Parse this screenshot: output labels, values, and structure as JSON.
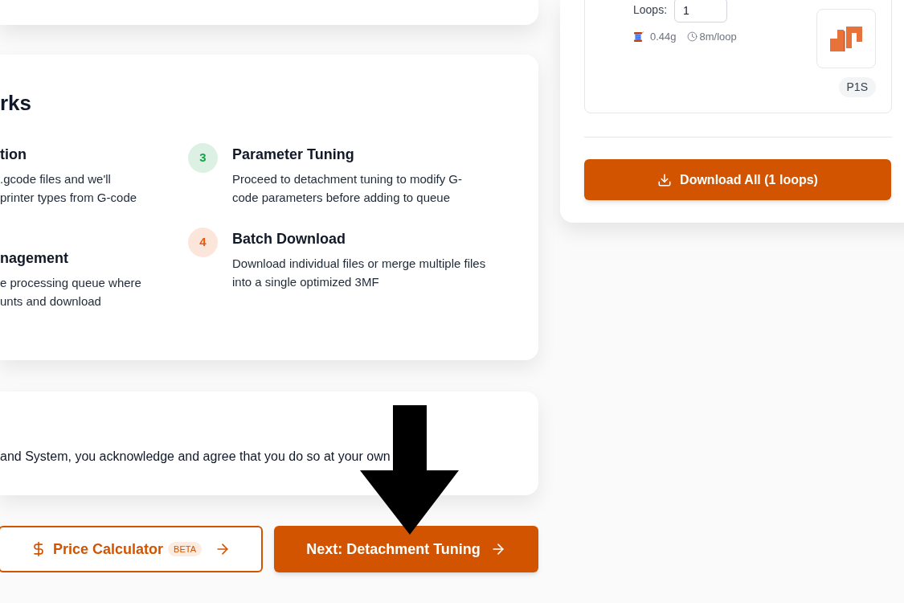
{
  "how_it_works": {
    "title": "rks",
    "columns": [
      {
        "steps": [
          {
            "title": "tion",
            "description": [
              ".gcode files and we'll",
              "printer types from G-code"
            ]
          },
          {
            "title": "nagement",
            "description": [
              "e processing queue where",
              "unts and download"
            ]
          }
        ]
      },
      {
        "steps": [
          {
            "number": "3",
            "color": "#16a34a",
            "title": "Parameter Tuning",
            "description": [
              "Proceed to detachment tuning to modify G-",
              "code parameters before adding to queue"
            ]
          },
          {
            "number": "4",
            "color": "#ea580c",
            "title": "Batch Download",
            "description": [
              "Download individual files or merge multiple files",
              "into a single optimized 3MF"
            ]
          }
        ]
      }
    ]
  },
  "disclaimer": {
    "text": "and System, you acknowledge and agree that you do so at your own"
  },
  "actions": [
    {
      "kind": "outline",
      "label": "Price Calculator",
      "badge": "BETA"
    },
    {
      "kind": "primary",
      "label": "Next: Detachment Tuning"
    }
  ],
  "print_panel": {
    "model_card": {
      "loops_label": "Loops:",
      "loops_value": "1",
      "filament": "0.44g",
      "time": "8m/loop",
      "printer": "P1S"
    },
    "download_button": "Download All (1 loops)"
  }
}
